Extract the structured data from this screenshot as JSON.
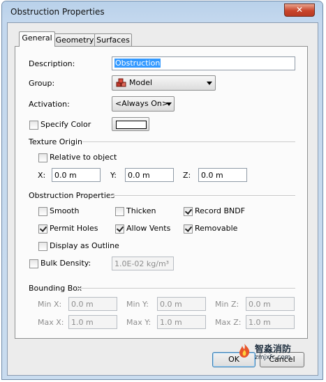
{
  "window": {
    "title": "Obstruction Properties",
    "close_label": "✕"
  },
  "tabs": [
    {
      "label": "General",
      "active": true
    },
    {
      "label": "Geometry"
    },
    {
      "label": "Surfaces"
    }
  ],
  "general": {
    "description_label": "Description:",
    "description_value": "Obstruction",
    "group_label": "Group:",
    "group_value": "Model",
    "activation_label": "Activation:",
    "activation_value": "<Always On>",
    "specify_color_label": "Specify Color",
    "specify_color_checked": false,
    "color_swatch": "#ffffff"
  },
  "texture_origin": {
    "section_label": "Texture Origin",
    "relative_label": "Relative to object",
    "relative_checked": false,
    "x_label": "X:",
    "x_value": "0.0 m",
    "y_label": "Y:",
    "y_value": "0.0 m",
    "z_label": "Z:",
    "z_value": "0.0 m"
  },
  "obstruction_props": {
    "section_label": "Obstruction Properties",
    "smooth_label": "Smooth",
    "smooth_checked": false,
    "thicken_label": "Thicken",
    "thicken_checked": false,
    "record_bndf_label": "Record BNDF",
    "record_bndf_checked": true,
    "permit_holes_label": "Permit Holes",
    "permit_holes_checked": true,
    "allow_vents_label": "Allow Vents",
    "allow_vents_checked": true,
    "removable_label": "Removable",
    "removable_checked": true,
    "display_outline_label": "Display as Outline",
    "display_outline_checked": false,
    "bulk_density_label": "Bulk Density:",
    "bulk_density_checked": false,
    "bulk_density_value": "1.0E-02 kg/m³"
  },
  "bounding_box": {
    "section_label": "Bounding Box",
    "min_x_label": "Min X:",
    "min_x_value": "0.0 m",
    "min_y_label": "Min Y:",
    "min_y_value": "0.0 m",
    "min_z_label": "Min Z:",
    "min_z_value": "0.0 m",
    "max_x_label": "Max X:",
    "max_x_value": "1.0 m",
    "max_y_label": "Max Y:",
    "max_y_value": "1.0 m",
    "max_z_label": "Max Z:",
    "max_z_value": "1.0 m"
  },
  "buttons": {
    "ok_label": "OK",
    "cancel_label": "Cancel"
  },
  "watermark": {
    "text_cn": "智淼消防",
    "text_url": "zmjxfc.com"
  },
  "colors": {
    "title_bar": "#b9d1ea",
    "selection": "#3399ff",
    "close_button": "#c9452b"
  }
}
